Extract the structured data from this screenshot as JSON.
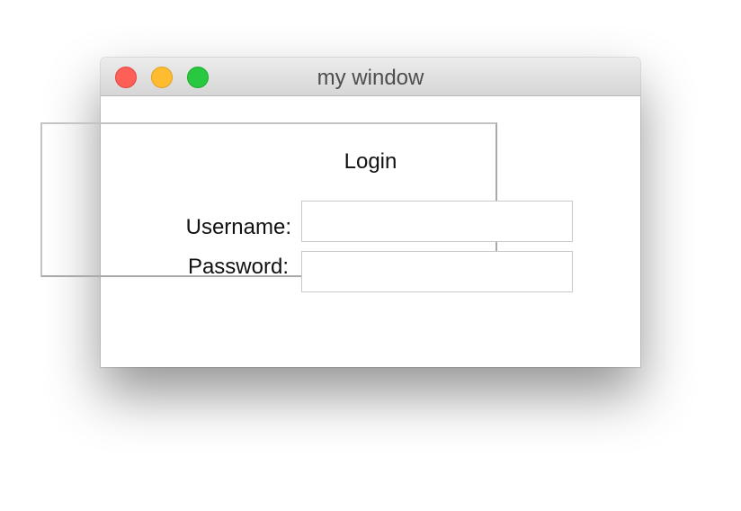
{
  "window": {
    "title": "my window",
    "controls": {
      "close": "close-button",
      "minimize": "minimize-button",
      "zoom": "zoom-button"
    }
  },
  "login": {
    "group_title": "Login",
    "username_label": "Username:",
    "username_value": "",
    "password_label": "Password:",
    "password_value": ""
  },
  "colors": {
    "close": "#fe5f57",
    "minimize": "#febc2e",
    "zoom": "#28c840"
  }
}
